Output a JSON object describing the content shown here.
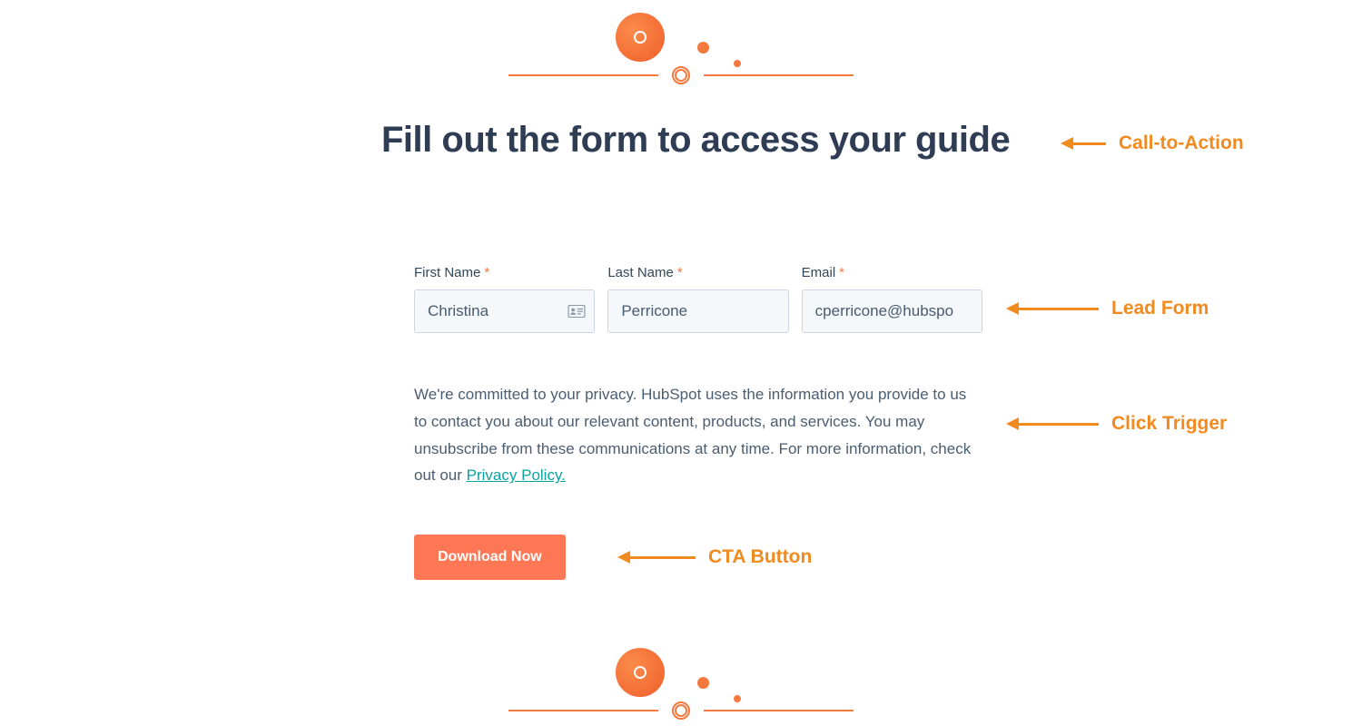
{
  "heading": "Fill out the form to access your guide",
  "form": {
    "first_name": {
      "label": "First Name",
      "value": "Christina",
      "required": true
    },
    "last_name": {
      "label": "Last Name",
      "value": "Perricone",
      "required": true
    },
    "email": {
      "label": "Email",
      "value": "cperricone@hubspo",
      "required": true
    }
  },
  "privacy": {
    "text": "We're committed to your privacy. HubSpot uses the information you provide to us to contact you about our relevant content, products, and services. You may unsubscribe from these communications at any time. For more information, check out our ",
    "link_label": "Privacy Policy."
  },
  "cta_button": "Download Now",
  "annotations": {
    "call_to_action": "Call-to-Action",
    "lead_form": "Lead Form",
    "click_trigger": "Click Trigger",
    "cta_button": "CTA Button"
  },
  "colors": {
    "accent": "#f4793f",
    "annotation": "#f18a1f",
    "heading": "#2e3c54",
    "link": "#0aa3a3",
    "cta_bg": "#ff7755"
  }
}
